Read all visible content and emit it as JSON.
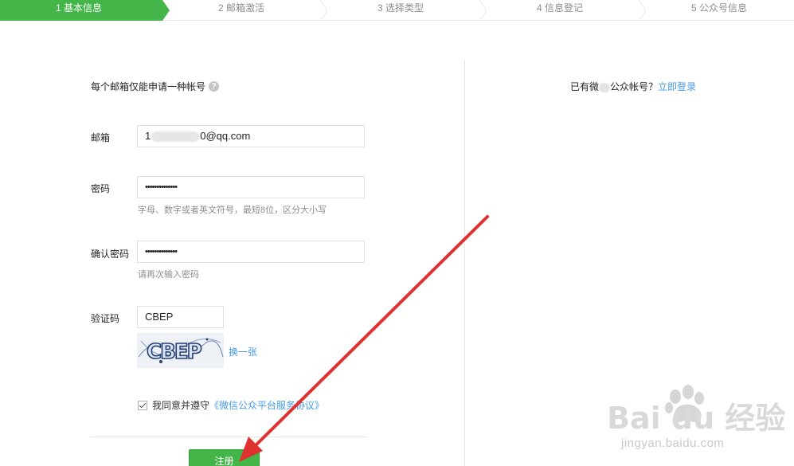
{
  "steps": [
    {
      "label": "1 基本信息",
      "active": true
    },
    {
      "label": "2 邮箱激活",
      "active": false
    },
    {
      "label": "3 选择类型",
      "active": false
    },
    {
      "label": "4 信息登记",
      "active": false
    },
    {
      "label": "5 公众号信息",
      "active": false
    }
  ],
  "form": {
    "intro": "每个邮箱仅能申请一种帐号",
    "email_label": "邮箱",
    "email_prefix": "1",
    "email_suffix": "0@qq.com",
    "password_label": "密码",
    "password_value": "••••••••••••••",
    "password_hint": "字母、数字或者英文符号，最短8位，区分大小写",
    "confirm_label": "确认密码",
    "confirm_value": "••••••••••••••",
    "confirm_hint": "请再次输入密码",
    "captcha_label": "验证码",
    "captcha_value": "CBEP",
    "captcha_image_text": "CBEP",
    "refresh_label": "换一张",
    "agree_text": "我同意并遵守",
    "agree_link": "《微信公众平台服务协议》",
    "register_label": "注册"
  },
  "side": {
    "login_prefix": "已有微",
    "login_middle": "公众帐号？",
    "login_link": "立即登录"
  },
  "watermark": {
    "brand": "Bai du 经验",
    "url": "jingyan.baidu.com"
  },
  "colors": {
    "accent": "#44b549",
    "link": "#459ae9",
    "annotation_arrow": "#e03131"
  }
}
